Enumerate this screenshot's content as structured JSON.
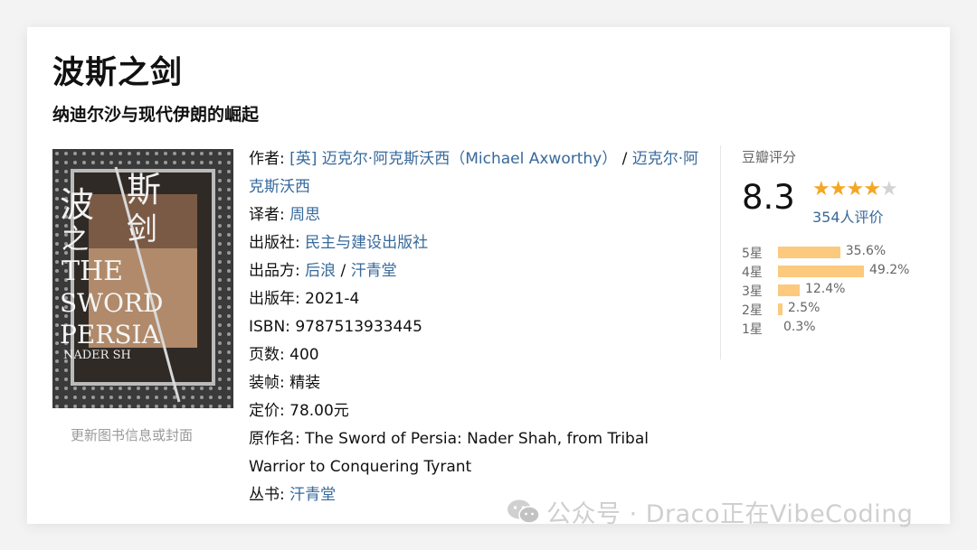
{
  "book": {
    "title": "波斯之剑",
    "subtitle": "纳迪尔沙与现代伊朗的崛起"
  },
  "cover": {
    "update_link": "更新图书信息或封面"
  },
  "info": {
    "author_label": "作者:",
    "author_value_1": "[英] 迈克尔·阿克斯沃西（Michael Axworthy）",
    "author_sep": " / ",
    "author_value_2": "迈克尔·阿克斯沃西",
    "translator_label": "译者:",
    "translator_value": "周思",
    "publisher_label": "出版社:",
    "publisher_value": "民主与建设出版社",
    "producer_label": "出品方:",
    "producer_value_1": "后浪",
    "producer_sep": " / ",
    "producer_value_2": "汗青堂",
    "year_label": "出版年:",
    "year_value": "2021-4",
    "isbn_label": "ISBN:",
    "isbn_value": "9787513933445",
    "pages_label": "页数:",
    "pages_value": "400",
    "binding_label": "装帧:",
    "binding_value": "精装",
    "price_label": "定价:",
    "price_value": "78.00元",
    "original_title_label": "原作名:",
    "original_title_value": "The Sword of Persia: Nader Shah, from Tribal Warrior to Conquering Tyrant",
    "series_label": "丛书:",
    "series_value": "汗青堂"
  },
  "rating": {
    "label": "豆瓣评分",
    "score": "8.3",
    "stars_filled": 4,
    "stars_total": 5,
    "votes": "354人评价",
    "distribution": [
      {
        "label": "5星",
        "pct_text": "35.6%",
        "pct": 35.6
      },
      {
        "label": "4星",
        "pct_text": "49.2%",
        "pct": 49.2
      },
      {
        "label": "3星",
        "pct_text": "12.4%",
        "pct": 12.4
      },
      {
        "label": "2星",
        "pct_text": "2.5%",
        "pct": 2.5
      },
      {
        "label": "1星",
        "pct_text": "0.3%",
        "pct": 0.3
      }
    ]
  },
  "watermark": {
    "text": "公众号 · Draco正在VibeCoding"
  },
  "colors": {
    "link": "#37699b",
    "star": "#f5a623",
    "bar": "#fbca7f"
  }
}
